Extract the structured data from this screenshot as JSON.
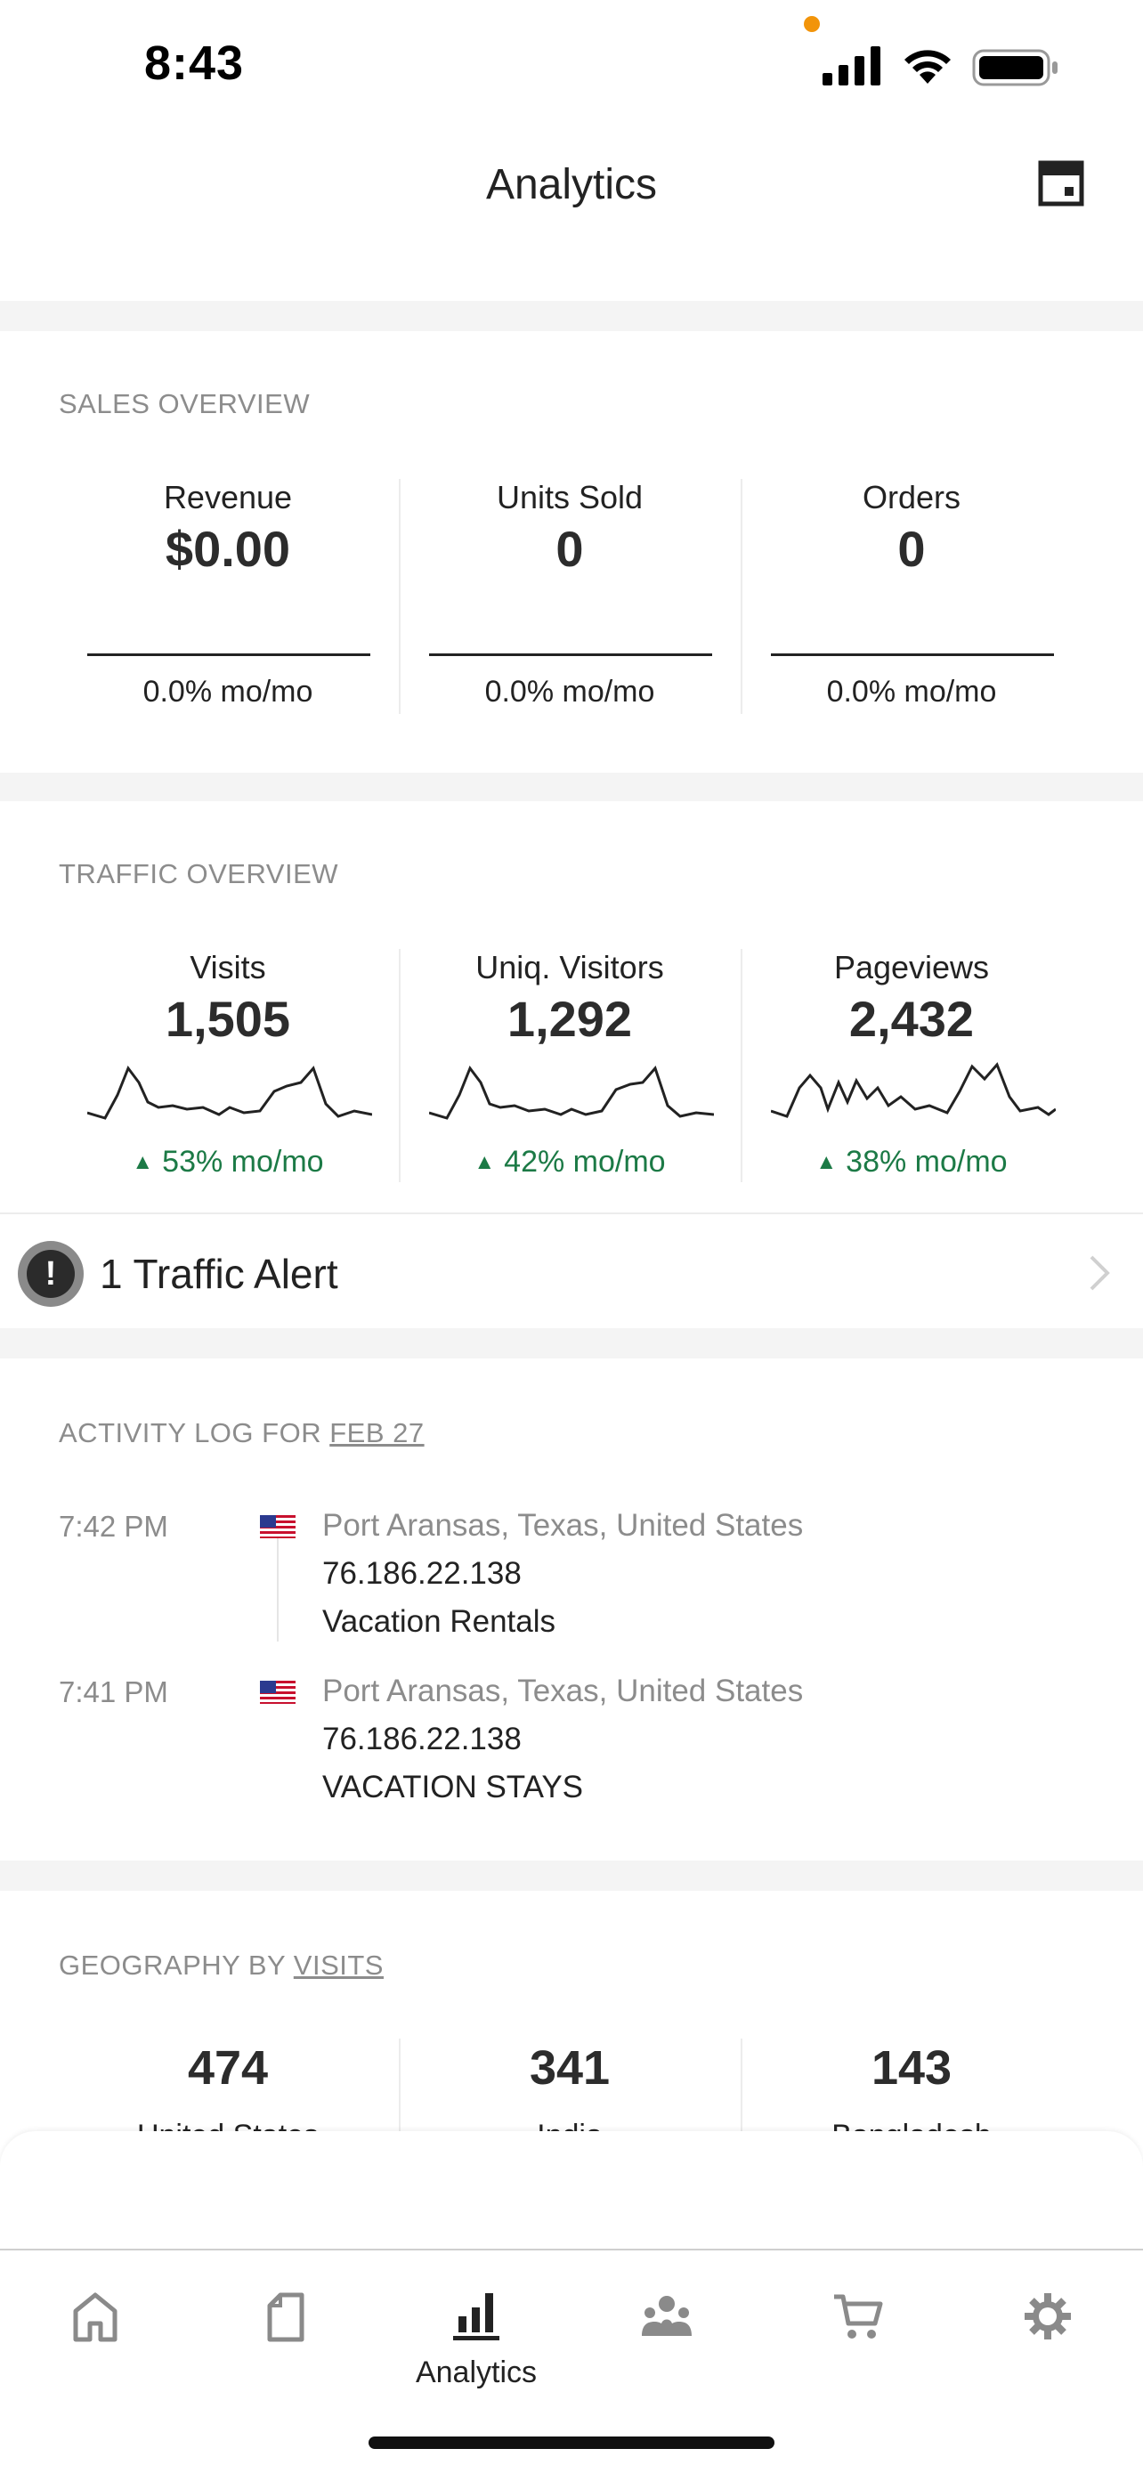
{
  "status_bar": {
    "time": "8:43",
    "recording_dot_color": "#f2940a",
    "icons": [
      "signal-icon",
      "wifi-icon",
      "battery-icon"
    ]
  },
  "header": {
    "title": "Analytics",
    "action_icon": "store-icon"
  },
  "sales_overview": {
    "label": "SALES OVERVIEW",
    "metrics": [
      {
        "label": "Revenue",
        "value": "$0.00",
        "change": "0.0% mo/mo"
      },
      {
        "label": "Units Sold",
        "value": "0",
        "change": "0.0% mo/mo"
      },
      {
        "label": "Orders",
        "value": "0",
        "change": "0.0% mo/mo"
      }
    ]
  },
  "traffic_overview": {
    "label": "TRAFFIC OVERVIEW",
    "metrics": [
      {
        "label": "Visits",
        "value": "1,505",
        "change": "53% mo/mo",
        "trend": "up"
      },
      {
        "label": "Uniq. Visitors",
        "value": "1,292",
        "change": "42% mo/mo",
        "trend": "up"
      },
      {
        "label": "Pageviews",
        "value": "2,432",
        "change": "38% mo/mo",
        "trend": "up"
      }
    ],
    "trend_color": "#1c7a46"
  },
  "traffic_alert": {
    "icon": "exclamation-icon",
    "text": "1 Traffic Alert"
  },
  "activity_log": {
    "label_prefix": "ACTIVITY LOG FOR ",
    "label_date": "FEB 27",
    "entries": [
      {
        "time": "7:42 PM",
        "flag": "us-flag-icon",
        "location": "Port Aransas, Texas, United States",
        "ip": "76.186.22.138",
        "page": "Vacation Rentals"
      },
      {
        "time": "7:41 PM",
        "flag": "us-flag-icon",
        "location": "Port Aransas, Texas, United States",
        "ip": "76.186.22.138",
        "page": "VACATION STAYS"
      }
    ]
  },
  "geography": {
    "label_prefix": "GEOGRAPHY BY ",
    "label_link": "VISITS",
    "countries": [
      {
        "value": "474",
        "name": "United States"
      },
      {
        "value": "341",
        "name": "India"
      },
      {
        "value": "143",
        "name": "Bangladesh"
      }
    ]
  },
  "tab_bar": {
    "tabs": [
      {
        "icon": "home-icon",
        "label": ""
      },
      {
        "icon": "document-icon",
        "label": ""
      },
      {
        "icon": "analytics-icon",
        "label": "Analytics",
        "active": true
      },
      {
        "icon": "customers-icon",
        "label": ""
      },
      {
        "icon": "cart-icon",
        "label": ""
      },
      {
        "icon": "settings-icon",
        "label": ""
      }
    ]
  }
}
